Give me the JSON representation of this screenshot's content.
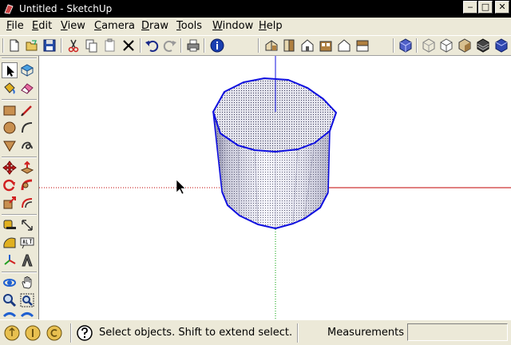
{
  "window": {
    "title": "Untitled - SketchUp"
  },
  "menu": [
    {
      "key": "F",
      "rest": "ile"
    },
    {
      "key": "E",
      "rest": "dit"
    },
    {
      "key": "V",
      "rest": "iew"
    },
    {
      "key": "C",
      "rest": "amera"
    },
    {
      "key": "D",
      "rest": "raw"
    },
    {
      "key": "T",
      "rest": "ools"
    },
    {
      "key": "W",
      "rest": "indow"
    },
    {
      "key": "H",
      "rest": "elp"
    }
  ],
  "status": {
    "hint": "Select objects. Shift to extend select. D",
    "measurements_label": "Measurements",
    "measurements_value": ""
  },
  "colors": {
    "edge_blue": "#1010e0",
    "axis_red": "#c00000",
    "axis_green": "#00a000",
    "face_top": "#e6e6ee"
  }
}
